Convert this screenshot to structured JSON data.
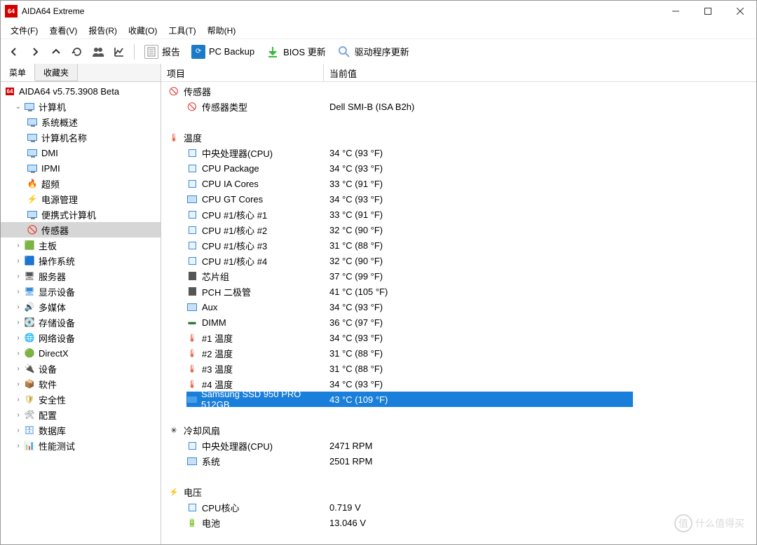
{
  "titlebar": {
    "app_icon_text": "64",
    "title": "AIDA64 Extreme"
  },
  "menubar": {
    "file": "文件(F)",
    "view": "查看(V)",
    "report": "报告(R)",
    "favorites": "收藏(O)",
    "tools": "工具(T)",
    "help": "帮助(H)"
  },
  "toolbar": {
    "report": "报告",
    "pcbackup": "PC Backup",
    "bios": "BIOS 更新",
    "drivers": "驱动程序更新"
  },
  "side_tabs": {
    "menu": "菜单",
    "fav": "收藏夹"
  },
  "tree": {
    "root": "AIDA64 v5.75.3908 Beta",
    "computer": "计算机",
    "computer_children": [
      "系统概述",
      "计算机名称",
      "DMI",
      "IPMI",
      "超频",
      "电源管理",
      "便携式计算机",
      "传感器"
    ],
    "others": [
      "主板",
      "操作系统",
      "服务器",
      "显示设备",
      "多媒体",
      "存储设备",
      "网络设备",
      "DirectX",
      "设备",
      "软件",
      "安全性",
      "配置",
      "数据库",
      "性能测试"
    ]
  },
  "icons": {
    "mb": "🟩",
    "os": "🟦",
    "srv": "🖥",
    "disp": "🖥",
    "mm": "🔊",
    "stor": "💽",
    "net": "🌐",
    "dx": "🟢",
    "dev": "🔌",
    "sw": "📦",
    "sec": "🛡",
    "cfg": "🛠",
    "db": "🗄",
    "perf": "📊"
  },
  "content": {
    "col_item": "项目",
    "col_val": "当前值",
    "groups": [
      {
        "name": "传感器",
        "icon": "sensor",
        "items": [
          {
            "label": "传感器类型",
            "value": "Dell SMI-B  (ISA B2h)",
            "icon": "sensor"
          }
        ]
      },
      {
        "name": "温度",
        "icon": "thermo",
        "items": [
          {
            "label": "中央处理器(CPU)",
            "value": "34 °C  (93 °F)",
            "icon": "cpu"
          },
          {
            "label": "CPU Package",
            "value": "34 °C  (93 °F)",
            "icon": "cpu"
          },
          {
            "label": "CPU IA Cores",
            "value": "33 °C  (91 °F)",
            "icon": "cpu"
          },
          {
            "label": "CPU GT Cores",
            "value": "34 °C  (93 °F)",
            "icon": "mon"
          },
          {
            "label": "CPU #1/核心 #1",
            "value": "33 °C  (91 °F)",
            "icon": "cpu"
          },
          {
            "label": "CPU #1/核心 #2",
            "value": "32 °C  (90 °F)",
            "icon": "cpu"
          },
          {
            "label": "CPU #1/核心 #3",
            "value": "31 °C  (88 °F)",
            "icon": "cpu"
          },
          {
            "label": "CPU #1/核心 #4",
            "value": "32 °C  (90 °F)",
            "icon": "cpu"
          },
          {
            "label": "芯片组",
            "value": "37 °C  (99 °F)",
            "icon": "chip"
          },
          {
            "label": "PCH 二极管",
            "value": "41 °C  (105 °F)",
            "icon": "chip"
          },
          {
            "label": "Aux",
            "value": "34 °C  (93 °F)",
            "icon": "mon"
          },
          {
            "label": "DIMM",
            "value": "36 °C  (97 °F)",
            "icon": "dimm"
          },
          {
            "label": "#1 温度",
            "value": "34 °C  (93 °F)",
            "icon": "th"
          },
          {
            "label": "#2 温度",
            "value": "31 °C  (88 °F)",
            "icon": "th"
          },
          {
            "label": "#3 温度",
            "value": "31 °C  (88 °F)",
            "icon": "th"
          },
          {
            "label": "#4 温度",
            "value": "34 °C  (93 °F)",
            "icon": "th"
          },
          {
            "label": "Samsung SSD 950 PRO 512GB",
            "value": "43 °C  (109 °F)",
            "icon": "ssd",
            "selected": true
          }
        ]
      },
      {
        "name": "冷却风扇",
        "icon": "fan",
        "items": [
          {
            "label": "中央处理器(CPU)",
            "value": "2471 RPM",
            "icon": "cpu"
          },
          {
            "label": "系统",
            "value": "2501 RPM",
            "icon": "mon"
          }
        ]
      },
      {
        "name": "电压",
        "icon": "volt",
        "items": [
          {
            "label": "CPU核心",
            "value": "0.719 V",
            "icon": "cpu"
          },
          {
            "label": "电池",
            "value": "13.046 V",
            "icon": "batt"
          }
        ]
      }
    ]
  },
  "watermark": "什么值得买"
}
